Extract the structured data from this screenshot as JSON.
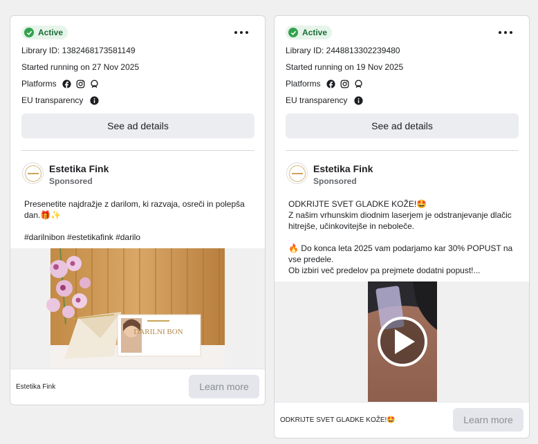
{
  "cards": [
    {
      "status": "Active",
      "library_id": "Library ID: 1382468173581149",
      "started": "Started running on 27 Nov 2025",
      "platforms_label": "Platforms",
      "eu_label": "EU transparency",
      "details_button": "See ad details",
      "advertiser": "Estetika Fink",
      "sponsored": "Sponsored",
      "body_lines": [
        "Presenetite najdražje z darilom, ki razvaja, osreči in polepša dan.🎁✨",
        "",
        "#darilnibon #estetikafink #darilo"
      ],
      "image_text": "DARILNI BON",
      "footer_caption": "Estetika Fink",
      "cta": "Learn more"
    },
    {
      "status": "Active",
      "library_id": "Library ID: 2448813302239480",
      "started": "Started running on 19 Nov 2025",
      "platforms_label": "Platforms",
      "eu_label": "EU transparency",
      "details_button": "See ad details",
      "advertiser": "Estetika Fink",
      "sponsored": "Sponsored",
      "body_lines": [
        "ODKRIJTE SVET GLADKE KOŽE!🤩",
        "Z našim vrhunskim diodnim laserjem je odstranjevanje dlačic hitrejše, učinkovitejše in neboleče.",
        "",
        "🔥 Do konca leta 2025 vam podarjamo kar 30% POPUST na vse predele.",
        "Ob izbiri več predelov pa prejmete dodatni popust!..."
      ],
      "footer_caption": "ODKRIJTE SVET GLADKE KOŽE!🤩",
      "cta": "Learn more"
    }
  ],
  "icons": [
    "check-icon",
    "more-icon",
    "facebook-icon",
    "instagram-icon",
    "messenger-icon",
    "info-icon",
    "play-icon"
  ],
  "colors": {
    "active_green": "#31a24c",
    "active_bg": "#e6f4ea",
    "button_bg": "#ebedf0"
  }
}
